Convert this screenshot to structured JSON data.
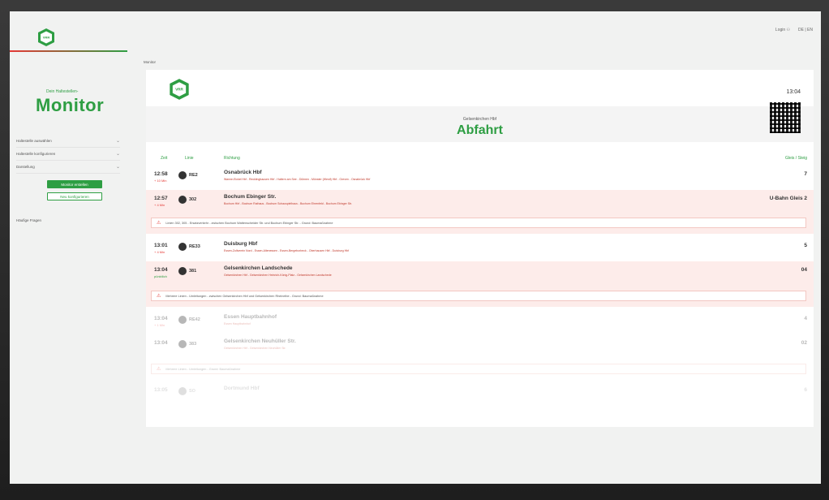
{
  "topbar": {
    "login": "Login ⚇",
    "lang": "DE | EN"
  },
  "sidebar": {
    "subtitle": "Dein Haltestellen-",
    "title": "Monitor",
    "menu": [
      {
        "label": "Haltestelle auswählen"
      },
      {
        "label": "Haltestelle konfigurieren"
      },
      {
        "label": "Darstellung"
      }
    ],
    "primary_button": "Monitor erstellen",
    "secondary_button": "Neu konfigurieren",
    "faq": "Häufige Fragen"
  },
  "breadcrumb": "Monitor",
  "monitor": {
    "clock": "13:04",
    "station": "Gelsenkirchen Hbf",
    "heading": "Abfahrt",
    "columns": {
      "time": "Zeit",
      "line": "Linie",
      "direction": "Richtung",
      "platform": "Gleis / Steig"
    },
    "rows": [
      {
        "time": "12:58",
        "delay": "+ 10 Min",
        "line": "RE2",
        "dest": "Osnabrück Hbf",
        "via": "Wanne-Eickel Hbf - Recklinghausen Hbf - Haltern am See - Dülmen - Münster (Westf) Hbf - Greven - Osnabrück Hbf",
        "platform": "7",
        "alert": false
      },
      {
        "time": "12:57",
        "delay": "+ 4 Min",
        "line": "302",
        "dest": "Bochum Ebinger Str.",
        "via": "Bochum Hbf - Bochum Rathaus - Bochum Schauspielhaus - Bochum Ehrenfeld - Bochum Ebinger Str.",
        "platform": "U-Bahn Gleis 2",
        "alert": true
      },
      {
        "time": "13:01",
        "delay": "+ 4 Min",
        "line": "RE33",
        "dest": "Duisburg Hbf",
        "via": "Essen-Zollverein Nord - Essen-Altenessen - Essen-Bergeborbeck - Oberhausen Hbf - Duisburg Hbf",
        "platform": "5",
        "alert": false
      },
      {
        "time": "13:04",
        "delay": "pünktlich",
        "line": "381",
        "dest": "Gelsenkirchen Landschede",
        "via": "Gelsenkirchen Hbf - Gelsenkirchen Heinrich-König-Platz - Gelsenkirchen Landschede",
        "platform": "04",
        "alert": true
      },
      {
        "time": "13:04",
        "delay": "+ 1 Min",
        "line": "RE42",
        "dest": "Essen Hauptbahnhof",
        "via": "Essen Hauptbahnhof",
        "platform": "4",
        "alert": false
      },
      {
        "time": "13:04",
        "delay": "",
        "line": "383",
        "dest": "Gelsenkirchen Neuhüller Str.",
        "via": "Gelsenkirchen Hbf - Gelsenkirchen Neuhüller Str.",
        "platform": "02",
        "alert": false
      },
      {
        "time": "13:05",
        "delay": "",
        "line": "SO",
        "dest": "Dortmund Hbf",
        "via": "",
        "platform": "6",
        "alert": false
      }
    ],
    "notices": [
      "Linien 302, 305 - Ersatzverkehr - zwischen Bochum Wattenscheider Str. und Bochum Ebinger Str. - Grund: Baumaßnahme",
      "Mehrere Linien - Umleitungen - zwischen Gelsenkirchen Hbf und Gelsenkirchen Rheinelbe - Grund: Baumaßnahme",
      "Mehrere Linien - Umleitungen - Grund: Baumaßnahme"
    ]
  },
  "colors": {
    "brand_green": "#2e9e43",
    "alert_red": "#e53935",
    "alert_bg": "#fdecea"
  }
}
